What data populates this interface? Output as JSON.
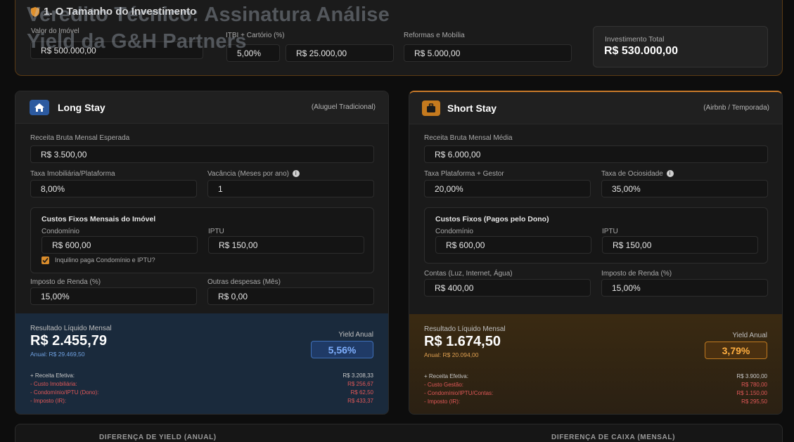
{
  "overlay_title": "Veredito Técnico: Assinatura Análise Yield da G&H Partners",
  "investment": {
    "section_title": "1. O Tamanho do Investimento",
    "property_value_label": "Valor do Imóvel",
    "property_value": "R$ 500.000,00",
    "itbi_label": "ITBI + Cartório (%)",
    "itbi_percent": "5,00%",
    "itbi_value": "R$ 25.000,00",
    "renovation_label": "Reformas e Mobília",
    "renovation_value": "R$ 5.000,00",
    "total_label": "Investimento Total",
    "total_value": "R$ 530.000,00"
  },
  "long_stay": {
    "title": "Long Stay",
    "subtitle": "(Aluguel Tradicional)",
    "gross_label": "Receita Bruta Mensal Esperada",
    "gross_value": "R$ 3.500,00",
    "fee_label": "Taxa Imobiliária/Plataforma",
    "fee_value": "8,00%",
    "vacancy_label": "Vacância (Meses por ano)",
    "vacancy_value": "1",
    "fixed_title": "Custos Fixos Mensais do Imóvel",
    "condo_label": "Condomínio",
    "condo_value": "R$ 600,00",
    "iptu_label": "IPTU",
    "iptu_value": "R$ 150,00",
    "tenant_pays_label": "Inquilino paga Condomínio e IPTU?",
    "tax_label": "Imposto de Renda (%)",
    "tax_value": "15,00%",
    "other_label": "Outras despesas (Mês)",
    "other_value": "R$ 0,00",
    "result_label": "Resultado Líquido Mensal",
    "result_value": "R$ 2.455,79",
    "result_annual": "Anual: R$ 29.469,50",
    "yield_label": "Yield Anual",
    "yield_value": "5,56%",
    "breakdown": [
      {
        "label": "+ Receita Efetiva:",
        "value": "R$ 3.208,33",
        "kind": "pos"
      },
      {
        "label": "- Custo Imobiliária:",
        "value": "R$ 256,67",
        "kind": "neg"
      },
      {
        "label": "- Condomínio/IPTU (Dono):",
        "value": "R$ 62,50",
        "kind": "neg"
      },
      {
        "label": "- Imposto (IR):",
        "value": "R$ 433,37",
        "kind": "neg"
      }
    ]
  },
  "short_stay": {
    "title": "Short Stay",
    "subtitle": "(Airbnb / Temporada)",
    "gross_label": "Receita Bruta Mensal Média",
    "gross_value": "R$ 6.000,00",
    "fee_label": "Taxa Plataforma + Gestor",
    "fee_value": "20,00%",
    "idle_label": "Taxa de Ociosidade",
    "idle_value": "35,00%",
    "fixed_title": "Custos Fixos (Pagos pelo Dono)",
    "condo_label": "Condomínio",
    "condo_value": "R$ 600,00",
    "iptu_label": "IPTU",
    "iptu_value": "R$ 150,00",
    "bills_label": "Contas (Luz, Internet, Água)",
    "bills_value": "R$ 400,00",
    "tax_label": "Imposto de Renda (%)",
    "tax_value": "15,00%",
    "result_label": "Resultado Líquido Mensal",
    "result_value": "R$ 1.674,50",
    "result_annual": "Anual: R$ 20.094,00",
    "yield_label": "Yield Anual",
    "yield_value": "3,79%",
    "breakdown": [
      {
        "label": "+ Receita Efetiva:",
        "value": "R$ 3.900,00",
        "kind": "pos"
      },
      {
        "label": "- Custo Gestão:",
        "value": "R$ 780,00",
        "kind": "neg"
      },
      {
        "label": "- Condomínio/IPTU/Contas:",
        "value": "R$ 1.150,00",
        "kind": "neg"
      },
      {
        "label": "- Imposto (IR):",
        "value": "R$ 295,50",
        "kind": "neg"
      }
    ]
  },
  "bottom": {
    "yield_diff_label": "DIFERENÇA DE YIELD (ANUAL)",
    "cash_diff_label": "DIFERENÇA DE CAIXA (MENSAL)"
  },
  "colors": {
    "long_accent": "#2c5aa0",
    "short_accent": "#c57a1e",
    "negative": "#e05858"
  },
  "icons": {
    "section": "shield-icon",
    "long": "home-icon",
    "short": "suitcase-icon",
    "info": "info-icon",
    "check": "check-icon"
  }
}
